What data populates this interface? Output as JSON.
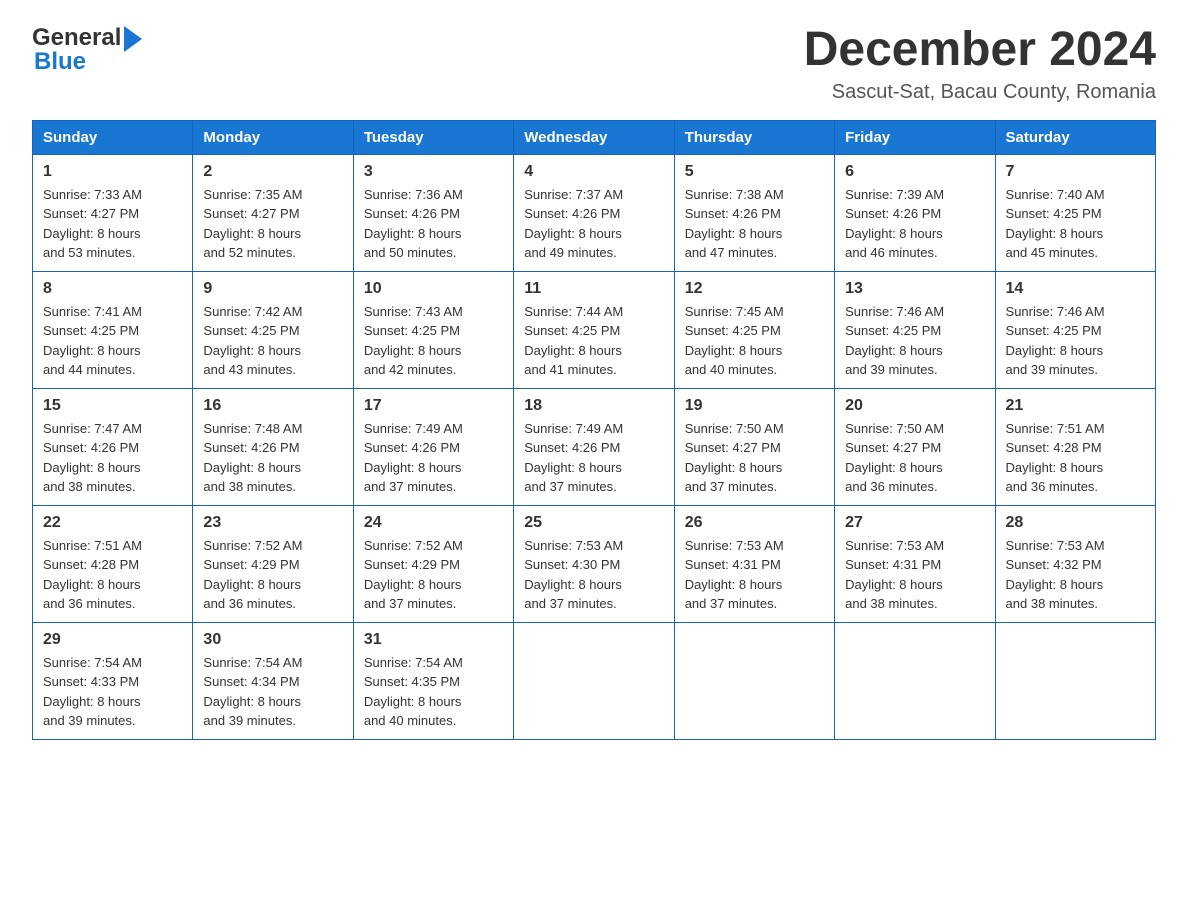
{
  "header": {
    "title": "December 2024",
    "location": "Sascut-Sat, Bacau County, Romania",
    "logo_line1": "General",
    "logo_line2": "Blue"
  },
  "days_of_week": [
    "Sunday",
    "Monday",
    "Tuesday",
    "Wednesday",
    "Thursday",
    "Friday",
    "Saturday"
  ],
  "weeks": [
    [
      {
        "day": "1",
        "sunrise": "7:33 AM",
        "sunset": "4:27 PM",
        "daylight": "8 hours and 53 minutes."
      },
      {
        "day": "2",
        "sunrise": "7:35 AM",
        "sunset": "4:27 PM",
        "daylight": "8 hours and 52 minutes."
      },
      {
        "day": "3",
        "sunrise": "7:36 AM",
        "sunset": "4:26 PM",
        "daylight": "8 hours and 50 minutes."
      },
      {
        "day": "4",
        "sunrise": "7:37 AM",
        "sunset": "4:26 PM",
        "daylight": "8 hours and 49 minutes."
      },
      {
        "day": "5",
        "sunrise": "7:38 AM",
        "sunset": "4:26 PM",
        "daylight": "8 hours and 47 minutes."
      },
      {
        "day": "6",
        "sunrise": "7:39 AM",
        "sunset": "4:26 PM",
        "daylight": "8 hours and 46 minutes."
      },
      {
        "day": "7",
        "sunrise": "7:40 AM",
        "sunset": "4:25 PM",
        "daylight": "8 hours and 45 minutes."
      }
    ],
    [
      {
        "day": "8",
        "sunrise": "7:41 AM",
        "sunset": "4:25 PM",
        "daylight": "8 hours and 44 minutes."
      },
      {
        "day": "9",
        "sunrise": "7:42 AM",
        "sunset": "4:25 PM",
        "daylight": "8 hours and 43 minutes."
      },
      {
        "day": "10",
        "sunrise": "7:43 AM",
        "sunset": "4:25 PM",
        "daylight": "8 hours and 42 minutes."
      },
      {
        "day": "11",
        "sunrise": "7:44 AM",
        "sunset": "4:25 PM",
        "daylight": "8 hours and 41 minutes."
      },
      {
        "day": "12",
        "sunrise": "7:45 AM",
        "sunset": "4:25 PM",
        "daylight": "8 hours and 40 minutes."
      },
      {
        "day": "13",
        "sunrise": "7:46 AM",
        "sunset": "4:25 PM",
        "daylight": "8 hours and 39 minutes."
      },
      {
        "day": "14",
        "sunrise": "7:46 AM",
        "sunset": "4:25 PM",
        "daylight": "8 hours and 39 minutes."
      }
    ],
    [
      {
        "day": "15",
        "sunrise": "7:47 AM",
        "sunset": "4:26 PM",
        "daylight": "8 hours and 38 minutes."
      },
      {
        "day": "16",
        "sunrise": "7:48 AM",
        "sunset": "4:26 PM",
        "daylight": "8 hours and 38 minutes."
      },
      {
        "day": "17",
        "sunrise": "7:49 AM",
        "sunset": "4:26 PM",
        "daylight": "8 hours and 37 minutes."
      },
      {
        "day": "18",
        "sunrise": "7:49 AM",
        "sunset": "4:26 PM",
        "daylight": "8 hours and 37 minutes."
      },
      {
        "day": "19",
        "sunrise": "7:50 AM",
        "sunset": "4:27 PM",
        "daylight": "8 hours and 37 minutes."
      },
      {
        "day": "20",
        "sunrise": "7:50 AM",
        "sunset": "4:27 PM",
        "daylight": "8 hours and 36 minutes."
      },
      {
        "day": "21",
        "sunrise": "7:51 AM",
        "sunset": "4:28 PM",
        "daylight": "8 hours and 36 minutes."
      }
    ],
    [
      {
        "day": "22",
        "sunrise": "7:51 AM",
        "sunset": "4:28 PM",
        "daylight": "8 hours and 36 minutes."
      },
      {
        "day": "23",
        "sunrise": "7:52 AM",
        "sunset": "4:29 PM",
        "daylight": "8 hours and 36 minutes."
      },
      {
        "day": "24",
        "sunrise": "7:52 AM",
        "sunset": "4:29 PM",
        "daylight": "8 hours and 37 minutes."
      },
      {
        "day": "25",
        "sunrise": "7:53 AM",
        "sunset": "4:30 PM",
        "daylight": "8 hours and 37 minutes."
      },
      {
        "day": "26",
        "sunrise": "7:53 AM",
        "sunset": "4:31 PM",
        "daylight": "8 hours and 37 minutes."
      },
      {
        "day": "27",
        "sunrise": "7:53 AM",
        "sunset": "4:31 PM",
        "daylight": "8 hours and 38 minutes."
      },
      {
        "day": "28",
        "sunrise": "7:53 AM",
        "sunset": "4:32 PM",
        "daylight": "8 hours and 38 minutes."
      }
    ],
    [
      {
        "day": "29",
        "sunrise": "7:54 AM",
        "sunset": "4:33 PM",
        "daylight": "8 hours and 39 minutes."
      },
      {
        "day": "30",
        "sunrise": "7:54 AM",
        "sunset": "4:34 PM",
        "daylight": "8 hours and 39 minutes."
      },
      {
        "day": "31",
        "sunrise": "7:54 AM",
        "sunset": "4:35 PM",
        "daylight": "8 hours and 40 minutes."
      },
      null,
      null,
      null,
      null
    ]
  ],
  "labels": {
    "sunrise": "Sunrise:",
    "sunset": "Sunset:",
    "daylight": "Daylight:"
  }
}
